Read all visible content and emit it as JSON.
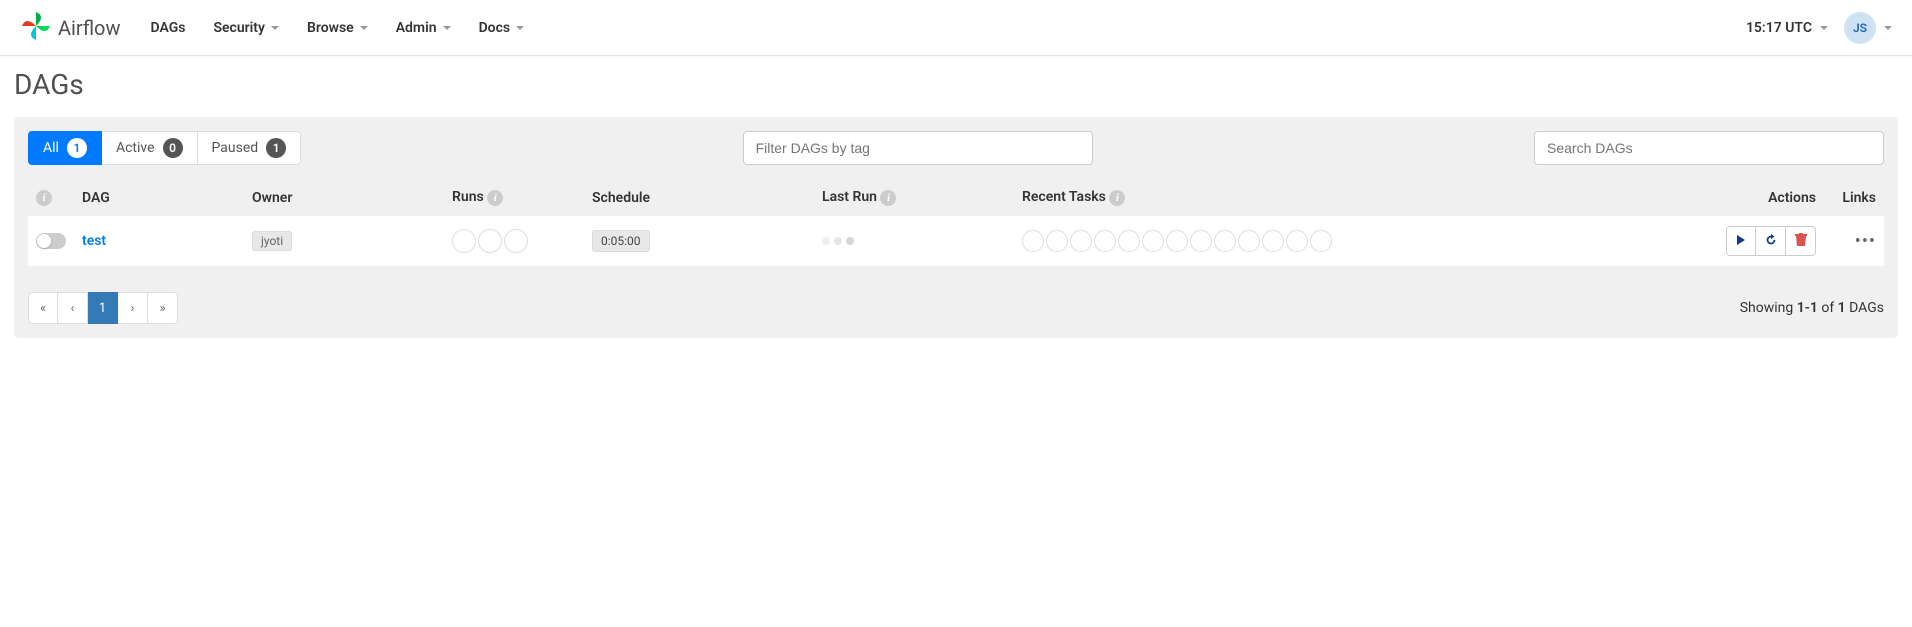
{
  "brand": "Airflow",
  "nav": {
    "dags": "DAGs",
    "security": "Security",
    "browse": "Browse",
    "admin": "Admin",
    "docs": "Docs"
  },
  "time": "15:17 UTC",
  "user_initials": "JS",
  "page_title": "DAGs",
  "filters": {
    "all_label": "All",
    "all_count": "1",
    "active_label": "Active",
    "active_count": "0",
    "paused_label": "Paused",
    "paused_count": "1"
  },
  "tag_filter_placeholder": "Filter DAGs by tag",
  "search_placeholder": "Search DAGs",
  "columns": {
    "dag": "DAG",
    "owner": "Owner",
    "runs": "Runs",
    "schedule": "Schedule",
    "last_run": "Last Run",
    "recent_tasks": "Recent Tasks",
    "actions": "Actions",
    "links": "Links"
  },
  "row": {
    "name": "test",
    "owner": "jyoti",
    "schedule": "0:05:00"
  },
  "pagination": {
    "first": "«",
    "prev": "‹",
    "page": "1",
    "next": "›",
    "last": "»"
  },
  "showing": {
    "prefix": "Showing ",
    "range": "1-1",
    "of": " of ",
    "total": "1",
    "suffix": " DAGs"
  }
}
